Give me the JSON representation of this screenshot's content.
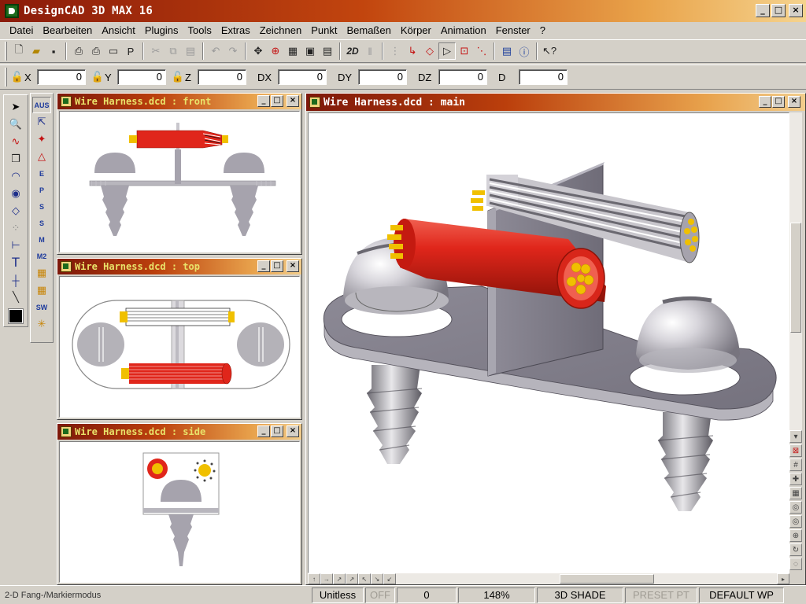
{
  "app": {
    "title": "DesignCAD 3D MAX 16",
    "window_buttons": [
      "_",
      "□",
      "×"
    ]
  },
  "menu": [
    "Datei",
    "Bearbeiten",
    "Ansicht",
    "Plugins",
    "Tools",
    "Extras",
    "Zeichnen",
    "Punkt",
    "Bemaßen",
    "Körper",
    "Animation",
    "Fenster",
    "?"
  ],
  "toolbar": {
    "icons": [
      "new-file-icon",
      "open-folder-icon",
      "save-icon",
      "print-icon",
      "print-preview-icon",
      "page-setup-icon",
      "print-properties-icon",
      "cut-icon",
      "copy-icon",
      "paste-icon",
      "undo-icon",
      "redo-icon",
      "move-view-icon",
      "zoom-window-icon",
      "window-tile-icon",
      "window-cascade-icon",
      "window-arrange-icon",
      "2d-toggle-icon",
      "grid-icon",
      "axis-icon",
      "snap-icon",
      "select-arrow-icon",
      "handles-icon",
      "point-icon",
      "layout-icon",
      "info-icon",
      "help-pointer-icon"
    ],
    "label_2d": "2D"
  },
  "coords": {
    "x_label": "X",
    "x_value": "0",
    "y_label": "Y",
    "y_value": "0",
    "z_label": "Z",
    "z_value": "0",
    "dx_label": "DX",
    "dx_value": "0",
    "dy_label": "DY",
    "dy_value": "0",
    "dz_label": "DZ",
    "dz_value": "0",
    "d_label": "D",
    "d_value": "0"
  },
  "palette1": [
    "select-arrow-icon",
    "zoom-icon",
    "curve-icon",
    "box-icon",
    "arc-icon",
    "circle-icon",
    "polygon-icon",
    "array-icon",
    "dimension-icon",
    "text-icon",
    "crosshair-icon",
    "line-icon"
  ],
  "palette2": {
    "top_label": "AUS",
    "items": [
      "E",
      "P",
      "S",
      "S",
      "M",
      "M2",
      "SW"
    ]
  },
  "windows": {
    "front": {
      "title": "Wire Harness.dcd : front"
    },
    "top": {
      "title": "Wire Harness.dcd : top"
    },
    "side": {
      "title": "Wire Harness.dcd : side"
    },
    "main": {
      "title": "Wire Harness.dcd : main"
    }
  },
  "status": {
    "mode": "2-D Fang-/Markiermodus",
    "units": "Unitless",
    "off": "OFF",
    "zero": "0",
    "zoom": "148%",
    "shade": "3D SHADE",
    "preset": "PRESET PT",
    "wp": "DEFAULT WP"
  },
  "colors": {
    "title_gradient_start": "#8a1a0a",
    "title_gradient_end": "#f5d38e",
    "child_title_text": "#e9e36a",
    "cable_red": "#e0261b",
    "metal_grey": "#a6a3ad",
    "connector_yellow": "#f0c000"
  }
}
